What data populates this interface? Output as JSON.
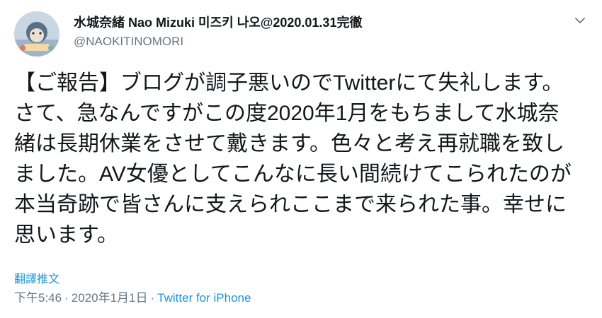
{
  "author": {
    "display_name": "水城奈緒 Nao Mizuki 미즈키 나오@2020.01.31完徹",
    "handle": "@NAOKITINOMORI"
  },
  "tweet": {
    "text": "【ご報告】ブログが調子悪いのでTwitterにて失礼します。\nさて、急なんですがこの度2020年1月をもちまして水城奈\n緒は長期休業をさせて戴きます。色々と考え再就職を致し\nました。AV女優としてこんなに長い間続けてこられたのが\n本当奇跡で皆さんに支えられここまで来られた事。幸せに\n思います。",
    "translate_label": "翻譯推文",
    "time": "下午5:46",
    "date": "2020年1月1日",
    "separator": "·",
    "source": "Twitter for iPhone"
  },
  "icons": {
    "avatar": "avatar-image",
    "menu": "chevron-down-icon"
  }
}
